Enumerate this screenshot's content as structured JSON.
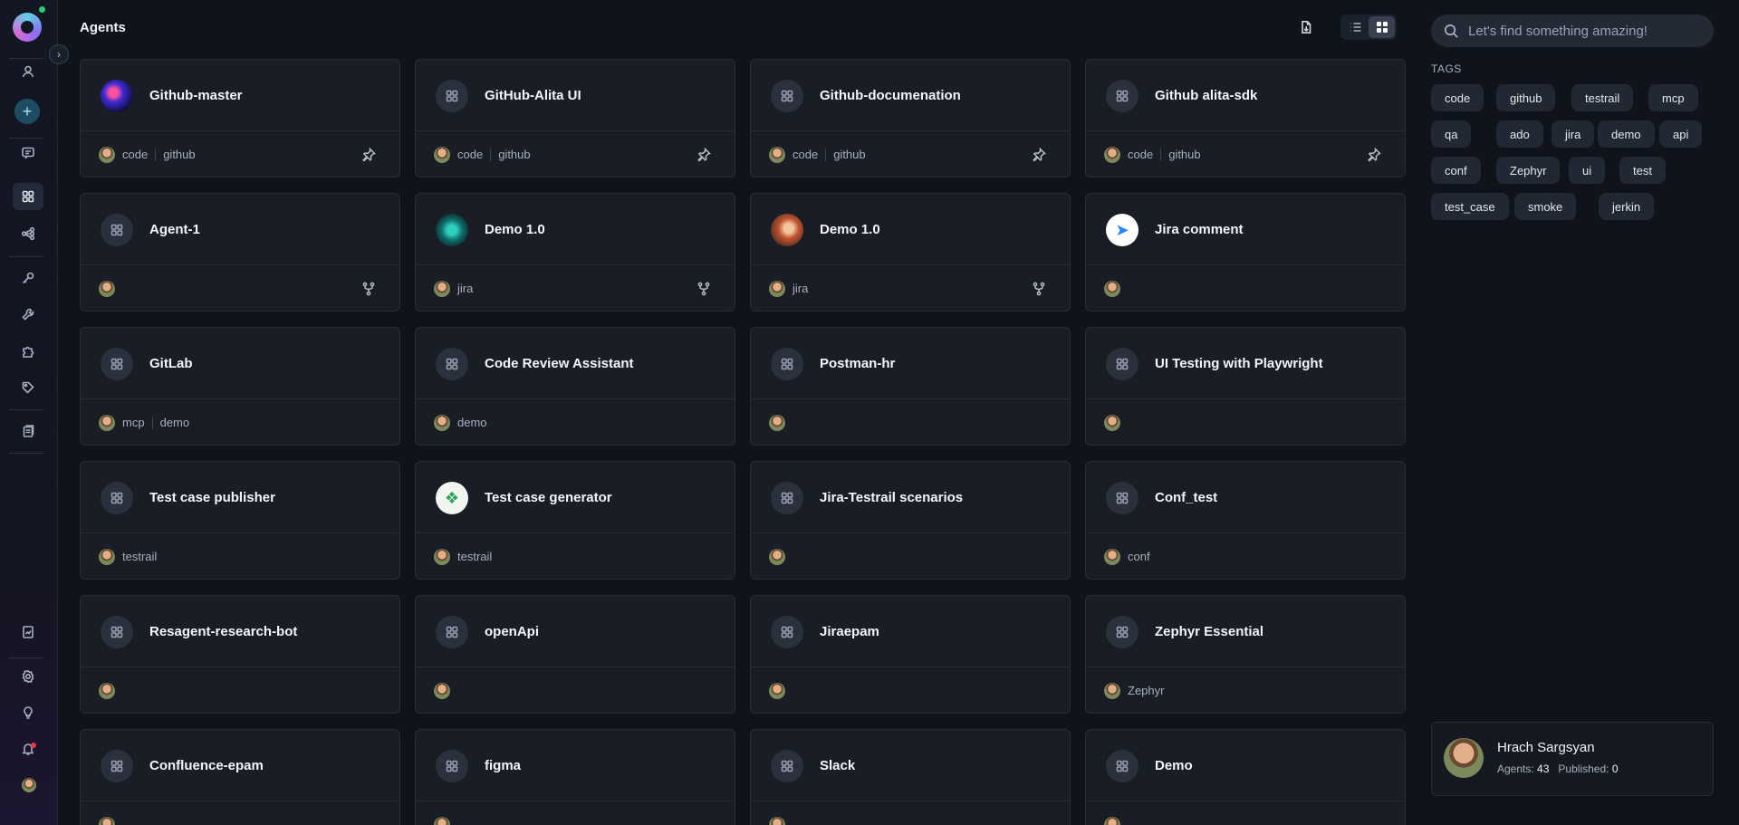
{
  "page": {
    "title": "Agents"
  },
  "search": {
    "placeholder": "Let's find something amazing!"
  },
  "tags_label": "TAGS",
  "tags": [
    "code",
    "github",
    "testrail",
    "mcp",
    "qa",
    "ado",
    "jira",
    "demo",
    "api",
    "conf",
    "Zephyr",
    "ui",
    "test",
    "test_case",
    "smoke",
    "jerkin"
  ],
  "agents": [
    {
      "name": "Github-master",
      "icon": "nebula-image",
      "tags": [
        "code",
        "github"
      ],
      "corner": "pin-icon"
    },
    {
      "name": "GitHub-Alita UI",
      "icon": "grid-icon",
      "tags": [
        "code",
        "github"
      ],
      "corner": "pin-icon"
    },
    {
      "name": "Github-documenation",
      "icon": "grid-icon",
      "tags": [
        "code",
        "github"
      ],
      "corner": "pin-icon"
    },
    {
      "name": "Github alita-sdk",
      "icon": "grid-icon",
      "tags": [
        "code",
        "github"
      ],
      "corner": "pin-icon"
    },
    {
      "name": "Agent-1",
      "icon": "grid-icon",
      "tags": [],
      "corner": "fork-icon"
    },
    {
      "name": "Demo 1.0",
      "icon": "teal-image",
      "tags": [
        "jira"
      ],
      "corner": "fork-icon"
    },
    {
      "name": "Demo 1.0",
      "icon": "robot-image",
      "tags": [
        "jira"
      ],
      "corner": "fork-icon"
    },
    {
      "name": "Jira comment",
      "icon": "jira-logo",
      "tags": [],
      "corner": ""
    },
    {
      "name": "GitLab",
      "icon": "grid-icon",
      "tags": [
        "mcp",
        "demo"
      ],
      "corner": ""
    },
    {
      "name": "Code Review Assistant",
      "icon": "grid-icon",
      "tags": [
        "demo"
      ],
      "corner": ""
    },
    {
      "name": "Postman-hr",
      "icon": "grid-icon",
      "tags": [],
      "corner": ""
    },
    {
      "name": "UI Testing with Playwright",
      "icon": "grid-icon",
      "tags": [],
      "corner": ""
    },
    {
      "name": "Test case publisher",
      "icon": "grid-icon",
      "tags": [
        "testrail"
      ],
      "corner": ""
    },
    {
      "name": "Test case generator",
      "icon": "testgen-logo",
      "tags": [
        "testrail"
      ],
      "corner": ""
    },
    {
      "name": "Jira-Testrail scenarios",
      "icon": "grid-icon",
      "tags": [],
      "corner": ""
    },
    {
      "name": "Conf_test",
      "icon": "grid-icon",
      "tags": [
        "conf"
      ],
      "corner": ""
    },
    {
      "name": "Resagent-research-bot",
      "icon": "grid-icon",
      "tags": [],
      "corner": ""
    },
    {
      "name": "openApi",
      "icon": "grid-icon",
      "tags": [],
      "corner": ""
    },
    {
      "name": "Jiraepam",
      "icon": "grid-icon",
      "tags": [],
      "corner": ""
    },
    {
      "name": "Zephyr Essential",
      "icon": "grid-icon",
      "tags": [
        "Zephyr"
      ],
      "corner": ""
    },
    {
      "name": "Confluence-epam",
      "icon": "grid-icon",
      "tags": [],
      "corner": ""
    },
    {
      "name": "figma",
      "icon": "grid-icon",
      "tags": [],
      "corner": ""
    },
    {
      "name": "Slack",
      "icon": "grid-icon",
      "tags": [],
      "corner": ""
    },
    {
      "name": "Demo",
      "icon": "grid-icon",
      "tags": [],
      "corner": ""
    }
  ],
  "user": {
    "name": "Hrach Sargsyan",
    "agents_label": "Agents:",
    "agents_count": "43",
    "published_label": "Published:",
    "published_count": "0"
  },
  "rail_icons": [
    "user-icon",
    "add-icon",
    "chat-icon",
    "agents-grid-icon",
    "pipelines-icon",
    "key-icon",
    "toolkit-icon",
    "puzzle-icon",
    "tag-icon",
    "collections-icon",
    "docs-icon",
    "settings-icon",
    "bulb-icon",
    "bell-icon"
  ],
  "colors": {
    "background": "#0f131b",
    "card": "#181d26",
    "accent": "#1e4d63",
    "notification": "#e63946"
  }
}
